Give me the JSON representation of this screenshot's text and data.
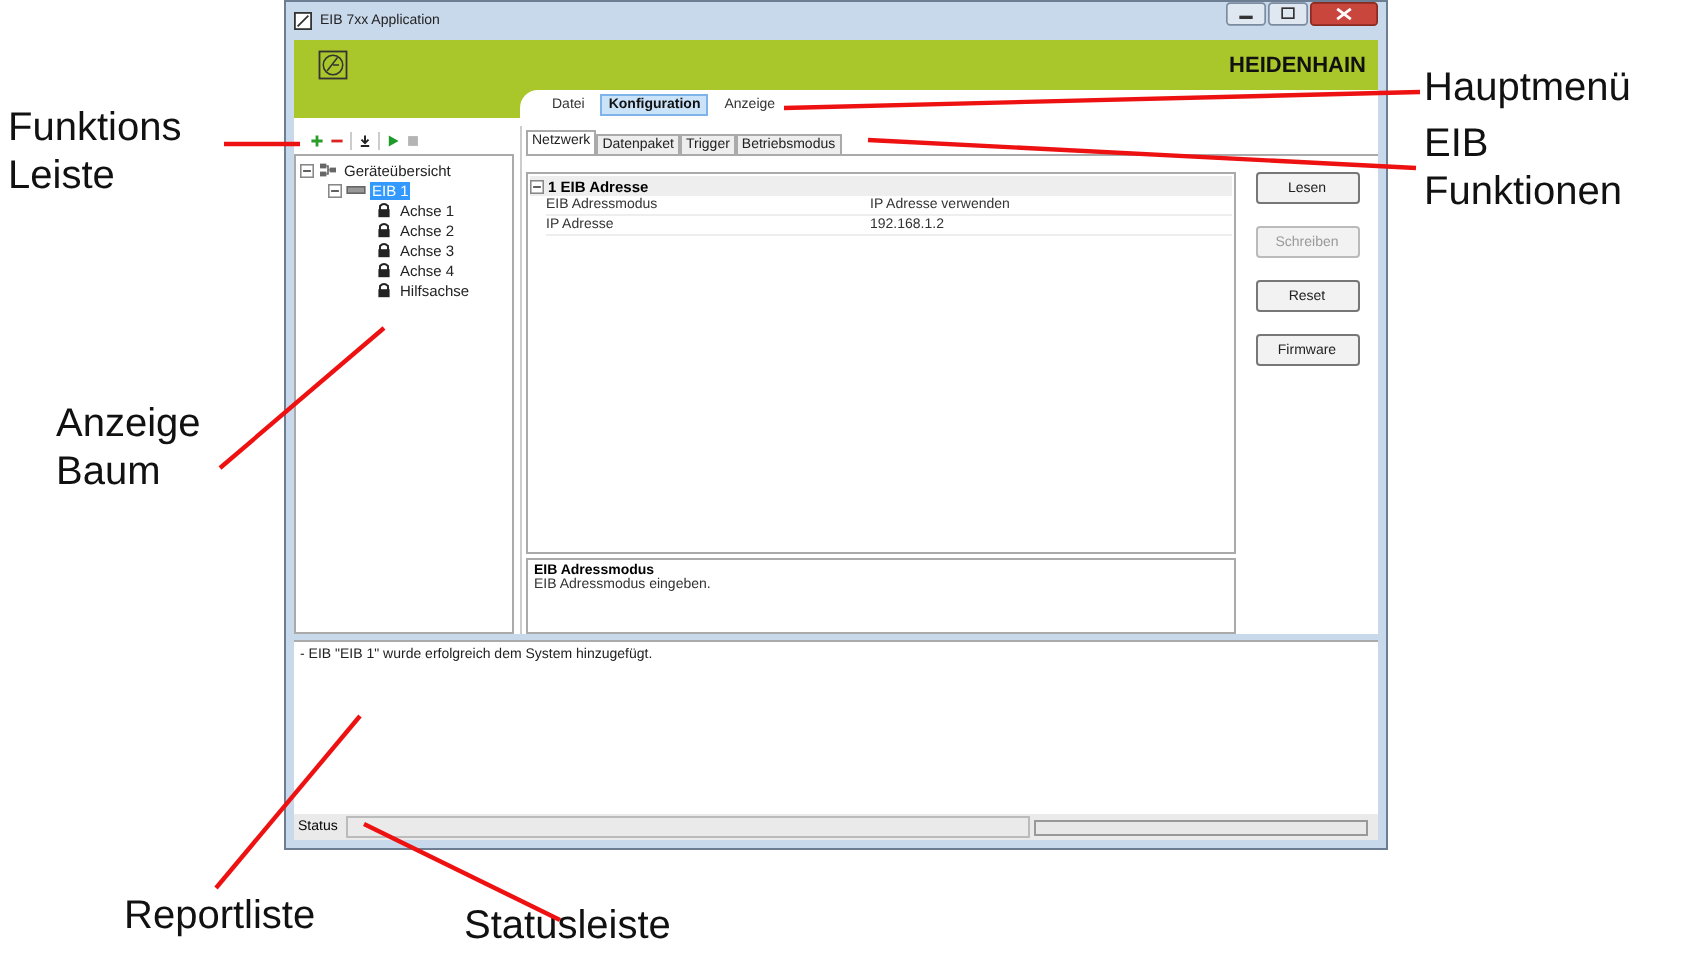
{
  "window": {
    "title": "EIB 7xx Application",
    "brand": "HEIDENHAIN"
  },
  "main_menu": [
    {
      "label": "Datei",
      "selected": false
    },
    {
      "label": "Konfiguration",
      "selected": true
    },
    {
      "label": "Anzeige",
      "selected": false
    }
  ],
  "toolbar": [
    {
      "kind": "add",
      "disabled": false
    },
    {
      "kind": "remove",
      "disabled": false
    },
    {
      "kind": "separator"
    },
    {
      "kind": "download",
      "disabled": false
    },
    {
      "kind": "separator"
    },
    {
      "kind": "play",
      "disabled": false
    },
    {
      "kind": "stop",
      "disabled": true
    }
  ],
  "tree": [
    {
      "label": "Geräteübersicht",
      "kind": "root",
      "expanded": true,
      "selected": false,
      "children": [
        {
          "label": "EIB 1",
          "kind": "device",
          "expanded": true,
          "selected": true,
          "children": [
            {
              "label": "Achse 1",
              "kind": "axis",
              "selected": false
            },
            {
              "label": "Achse 2",
              "kind": "axis",
              "selected": false
            },
            {
              "label": "Achse 3",
              "kind": "axis",
              "selected": false
            },
            {
              "label": "Achse 4",
              "kind": "axis",
              "selected": false
            },
            {
              "label": "Hilfsachse",
              "kind": "axis",
              "selected": false
            }
          ]
        }
      ]
    }
  ],
  "tabs": [
    {
      "label": "Netzwerk",
      "selected": true
    },
    {
      "label": "Datenpaket",
      "selected": false
    },
    {
      "label": "Trigger",
      "selected": false
    },
    {
      "label": "Betriebsmodus",
      "selected": false
    }
  ],
  "property_grid": {
    "category": {
      "label": "1 EIB Adresse",
      "expanded": true
    },
    "rows": [
      {
        "name": "EIB Adressmodus",
        "value": "IP Adresse verwenden",
        "selected": false
      },
      {
        "name": "IP Adresse",
        "value": "192.168.1.2",
        "selected": false
      }
    ]
  },
  "description": {
    "title": "EIB Adressmodus",
    "text": "EIB Adressmodus eingeben."
  },
  "buttons": [
    {
      "label": "Lesen",
      "disabled": false
    },
    {
      "label": "Schreiben",
      "disabled": true
    },
    {
      "label": "Reset",
      "disabled": false
    },
    {
      "label": "Firmware",
      "disabled": false
    }
  ],
  "report": [
    "- EIB \"EIB 1\" wurde erfolgreich dem System hinzugefügt."
  ],
  "status_bar": {
    "label": "Status"
  },
  "annotations": [
    {
      "lines": [
        "Funktions",
        "Leiste"
      ]
    },
    {
      "lines": [
        "Anzeige",
        "Baum"
      ]
    },
    {
      "lines": [
        "Reportliste"
      ]
    },
    {
      "lines": [
        "Statusleiste"
      ]
    },
    {
      "lines": [
        "Hauptmenü"
      ]
    },
    {
      "lines": [
        "EIB",
        "Funktionen"
      ]
    }
  ]
}
